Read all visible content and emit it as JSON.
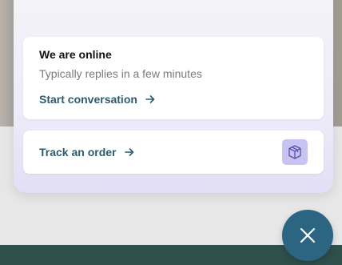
{
  "widget": {
    "online_card": {
      "title": "We are online",
      "subtitle": "Typically replies in a few minutes",
      "start_label": "Start conversation"
    },
    "track_card": {
      "label": "Track an order"
    },
    "icons": {
      "start_arrow": "arrow-right-icon",
      "track_arrow": "arrow-right-icon",
      "box": "package-icon",
      "close": "close-icon"
    }
  },
  "colors": {
    "link": "#2e5c6e",
    "fab": "#2b6581",
    "box_badge": "#c9c3f4",
    "footer": "#2f4f4c"
  }
}
